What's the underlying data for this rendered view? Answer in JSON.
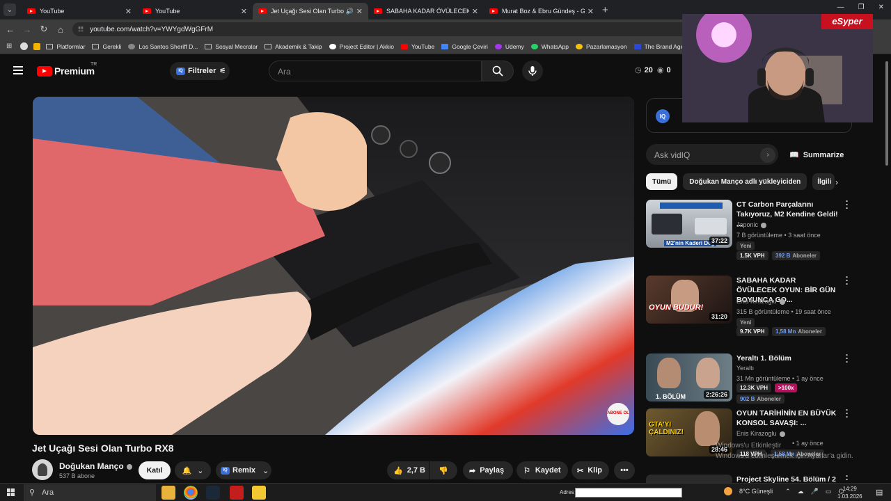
{
  "browser": {
    "tabs": [
      {
        "title": "YouTube",
        "active": false
      },
      {
        "title": "YouTube",
        "active": false
      },
      {
        "title": "Jet Uçağı Sesi Olan Turbo R",
        "active": true
      },
      {
        "title": "SABAHA KADAR ÖVÜLECEK OY",
        "active": false
      },
      {
        "title": "Murat Boz & Ebru Gündeş - Gü",
        "active": false
      }
    ],
    "url": "youtube.com/watch?v=YWYgdWgGFrM",
    "bookmarks": [
      "Platformlar",
      "Gerekli",
      "Los Santos Sheriff D...",
      "Sosyal Mecralar",
      "Akademik & Takip",
      "Project Editor | Akkio",
      "YouTube",
      "Google Çeviri",
      "Udemy",
      "WhatsApp",
      "Pazarlamasyon",
      "The Brand Age"
    ]
  },
  "header": {
    "logo": "Premium",
    "logo_country": "TR",
    "filter_label": "Filtreler",
    "iq_label": "IQ",
    "search_placeholder": "Ara",
    "stat_1": "20",
    "stat_2": "0"
  },
  "video": {
    "title": "Jet Uçağı Sesi Olan Turbo RX8",
    "abone_badge": "ABONE OL",
    "channel": "Doğukan Manço",
    "subscribers": "537 B abone",
    "join_label": "Katıl",
    "remix_label": "Remix",
    "likes": "2,7 B",
    "share_label": "Paylaş",
    "save_label": "Kaydet",
    "clip_label": "Klip"
  },
  "sidebar": {
    "ask_placeholder": "Ask vidIQ",
    "summarize_label": "Summarize",
    "chips": [
      "Tümü",
      "Doğukan Manço adlı yükleyiciden",
      "İlgili"
    ],
    "recommendations": [
      {
        "title": "CT Carbon Parçalarını Takıyoruz, M2 Kendine Geldi! ...",
        "channel": "Japonic",
        "meta": "7 B görüntüleme • 3 saat önce",
        "duration": "37:22",
        "badge_new": "Yeni",
        "vph": "1.5K VPH",
        "subs": "392 B",
        "subs_label": "Aboneler",
        "thumb_text": "M2'nin Kaderi Değ"
      },
      {
        "title": "SABAHA KADAR ÖVÜLECEK OYUN: BİR GÜN BOYUNCA GO...",
        "channel": "Enis Kirazoglu",
        "meta": "315 B görüntüleme • 19 saat önce",
        "duration": "31:20",
        "badge_new": "Yeni",
        "vph": "9.7K VPH",
        "subs": "1,58 Mn",
        "subs_label": "Aboneler",
        "thumb_text": "OYUN BUDUR!"
      },
      {
        "title": "Yeraltı 1. Bölüm",
        "channel": "Yeraltı",
        "meta": "31 Mn görüntüleme • 1 ay önce",
        "duration": "2:26:26",
        "vph": "12.3K VPH",
        "multiplier": ">100x",
        "subs": "902 B",
        "subs_label": "Aboneler",
        "thumb_text": "1. BÖLÜM"
      },
      {
        "title": "OYUN TARİHİNİN EN BÜYÜK KONSOL SAVAŞI: ...",
        "channel": "Enis Kirazoglu",
        "meta": "• 1 ay önce",
        "duration": "28:46",
        "vph": "118 VPH",
        "subs": "1,58 Mn",
        "subs_label": "Aboneler",
        "thumb_text": "GTA'YI ÇALDINIZ!"
      },
      {
        "title": "Project Skyline 54. Bölüm / 2"
      }
    ]
  },
  "overlay": {
    "streamer_tag": "eSyper",
    "windows_activate_1": "Windows'u Etkinleştir",
    "windows_activate_2": "Windows'u etkinleştirmek için Ayarlar'a gidin."
  },
  "taskbar": {
    "search_placeholder": "Ara",
    "address_label": "Adres",
    "weather": "8°C Güneşli",
    "time": "14:29",
    "date": "1.03.2026"
  },
  "colors": {
    "accent_red": "#ff0000",
    "bg": "#0f0f0f",
    "vidiq_blue": "#3b6fd8",
    "sub_blue": "#6f9ff5"
  }
}
